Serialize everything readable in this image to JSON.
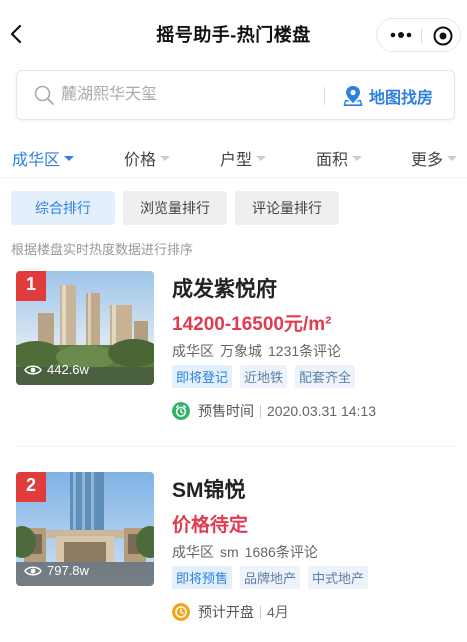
{
  "header": {
    "title": "摇号助手-热门楼盘"
  },
  "search": {
    "placeholder": "麓湖熙华天玺",
    "map_label": "地图找房"
  },
  "filters": [
    {
      "label": "成华区",
      "active": true
    },
    {
      "label": "价格",
      "active": false
    },
    {
      "label": "户型",
      "active": false
    },
    {
      "label": "面积",
      "active": false
    },
    {
      "label": "更多",
      "active": false
    }
  ],
  "sort_tabs": [
    {
      "label": "综合排行",
      "active": true
    },
    {
      "label": "浏览量排行",
      "active": false
    },
    {
      "label": "评论量排行",
      "active": false
    }
  ],
  "sort_hint": "根据楼盘实时热度数据进行排序",
  "listings": [
    {
      "rank": "1",
      "views": "442.6w",
      "name": "成发紫悦府",
      "price": "14200-16500元/m²",
      "district": "成华区",
      "area": "万象城",
      "comments": "1231条评论",
      "tags": [
        "即将登记",
        "近地铁",
        "配套齐全"
      ],
      "sale_label": "预售时间",
      "sale_value": "2020.03.31 14:13",
      "sale_icon_color": "#2fb36a"
    },
    {
      "rank": "2",
      "views": "797.8w",
      "name": "SM锦悦",
      "price": "价格待定",
      "district": "成华区",
      "area": "sm",
      "comments": "1686条评论",
      "tags": [
        "即将预售",
        "品牌地产",
        "中式地产"
      ],
      "sale_label": "预计开盘",
      "sale_value": "4月",
      "sale_icon_color": "#f2a51a"
    }
  ],
  "colors": {
    "accent": "#2f80e0",
    "price": "#e03c50",
    "rank_badge": "#e03c3c"
  }
}
